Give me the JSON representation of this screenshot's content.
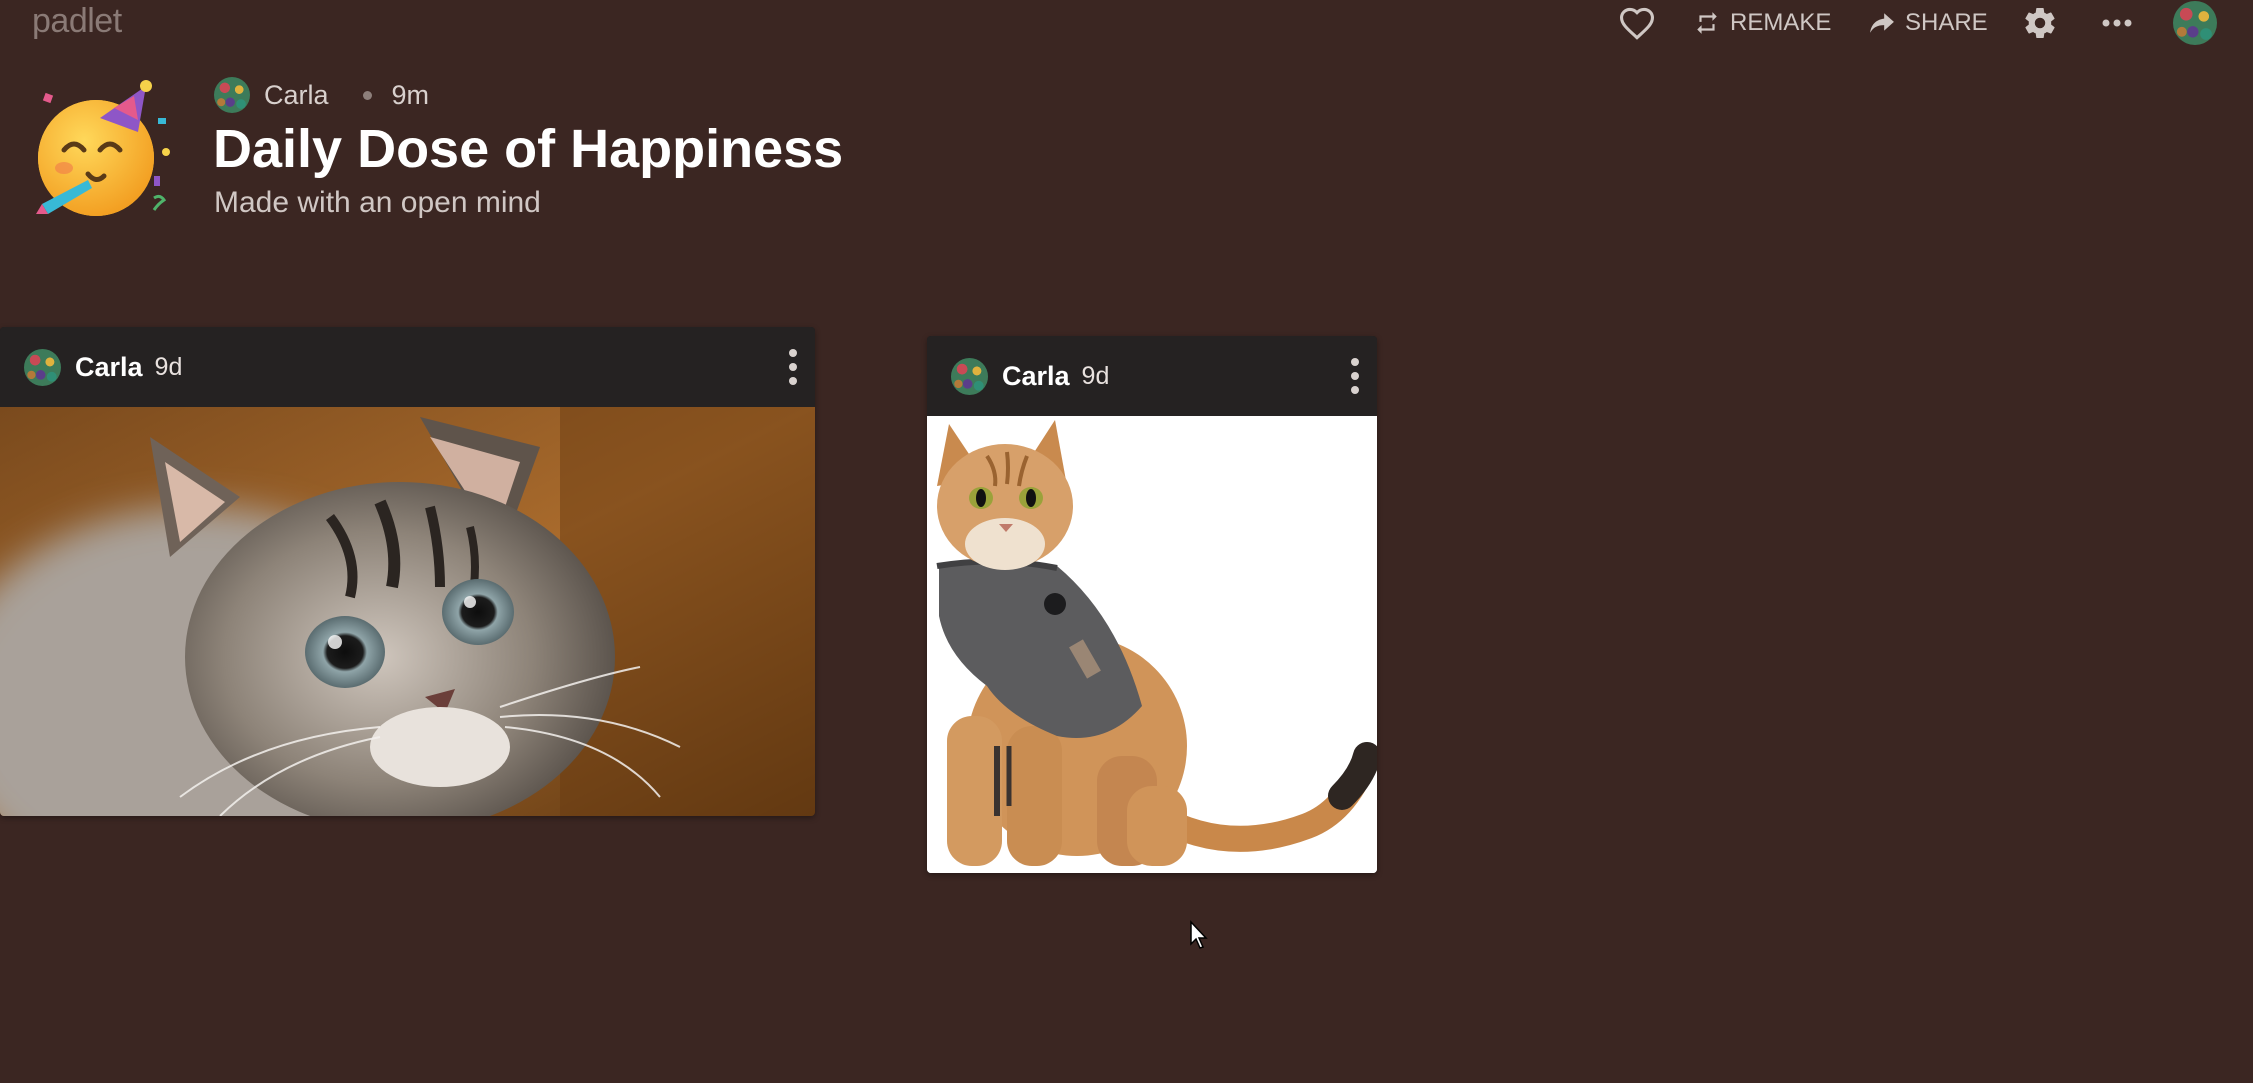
{
  "app": {
    "logo": "padlet"
  },
  "toolbar": {
    "like_icon": "heart-icon",
    "remake_label": "REMAKE",
    "share_label": "SHARE",
    "settings_icon": "gear-icon",
    "more_icon": "ellipsis-icon"
  },
  "board": {
    "author": "Carla",
    "edited": "9m",
    "title": "Daily Dose of Happiness",
    "subtitle": "Made with an open mind",
    "icon": "partying-face-emoji"
  },
  "posts": [
    {
      "author": "Carla",
      "time": "9d",
      "image": "kitten-photo"
    },
    {
      "author": "Carla",
      "time": "9d",
      "image": "cat-in-anxiety-vest-photo"
    }
  ],
  "colors": {
    "background": "#3b2622",
    "post_header": "#252222",
    "text_primary": "#ffffff",
    "text_muted": "#d0c7c4"
  }
}
